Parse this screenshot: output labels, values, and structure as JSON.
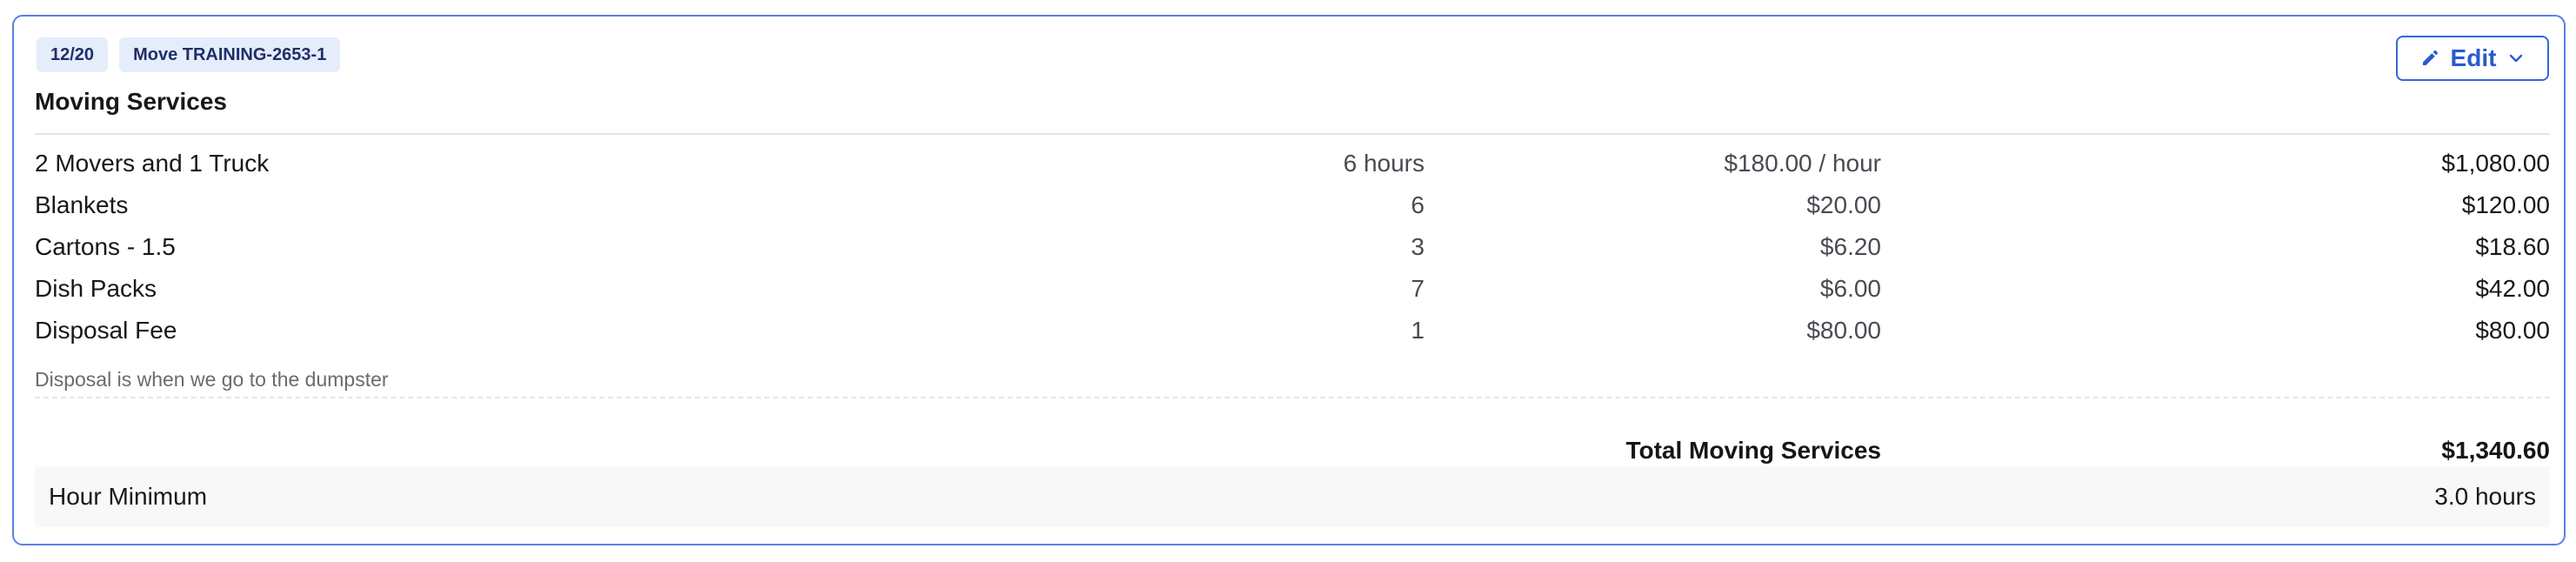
{
  "badges": [
    "12/20",
    "Move TRAINING-2653-1"
  ],
  "section": {
    "title": "Moving Services"
  },
  "edit_button": {
    "label": "Edit"
  },
  "items": [
    {
      "name": "2 Movers and 1 Truck",
      "qty": "6 hours",
      "rate": "$180.00 / hour",
      "total": "$1,080.00"
    },
    {
      "name": "Blankets",
      "qty": "6",
      "rate": "$20.00",
      "total": "$120.00"
    },
    {
      "name": "Cartons - 1.5",
      "qty": "3",
      "rate": "$6.20",
      "total": "$18.60"
    },
    {
      "name": "Dish Packs",
      "qty": "7",
      "rate": "$6.00",
      "total": "$42.00"
    },
    {
      "name": "Disposal Fee",
      "qty": "1",
      "rate": "$80.00",
      "total": "$80.00",
      "description": "Disposal is when we go to the dumpster"
    }
  ],
  "summary": {
    "total_label": "Total Moving Services",
    "total_value": "$1,340.60"
  },
  "hour_minimum": {
    "label": "Hour Minimum",
    "value": "3.0 hours"
  },
  "colors": {
    "accent": "#3566d8",
    "card_border": "#5b7fe8",
    "badge_bg": "#e5edfb",
    "badge_text": "#1f2f66"
  }
}
